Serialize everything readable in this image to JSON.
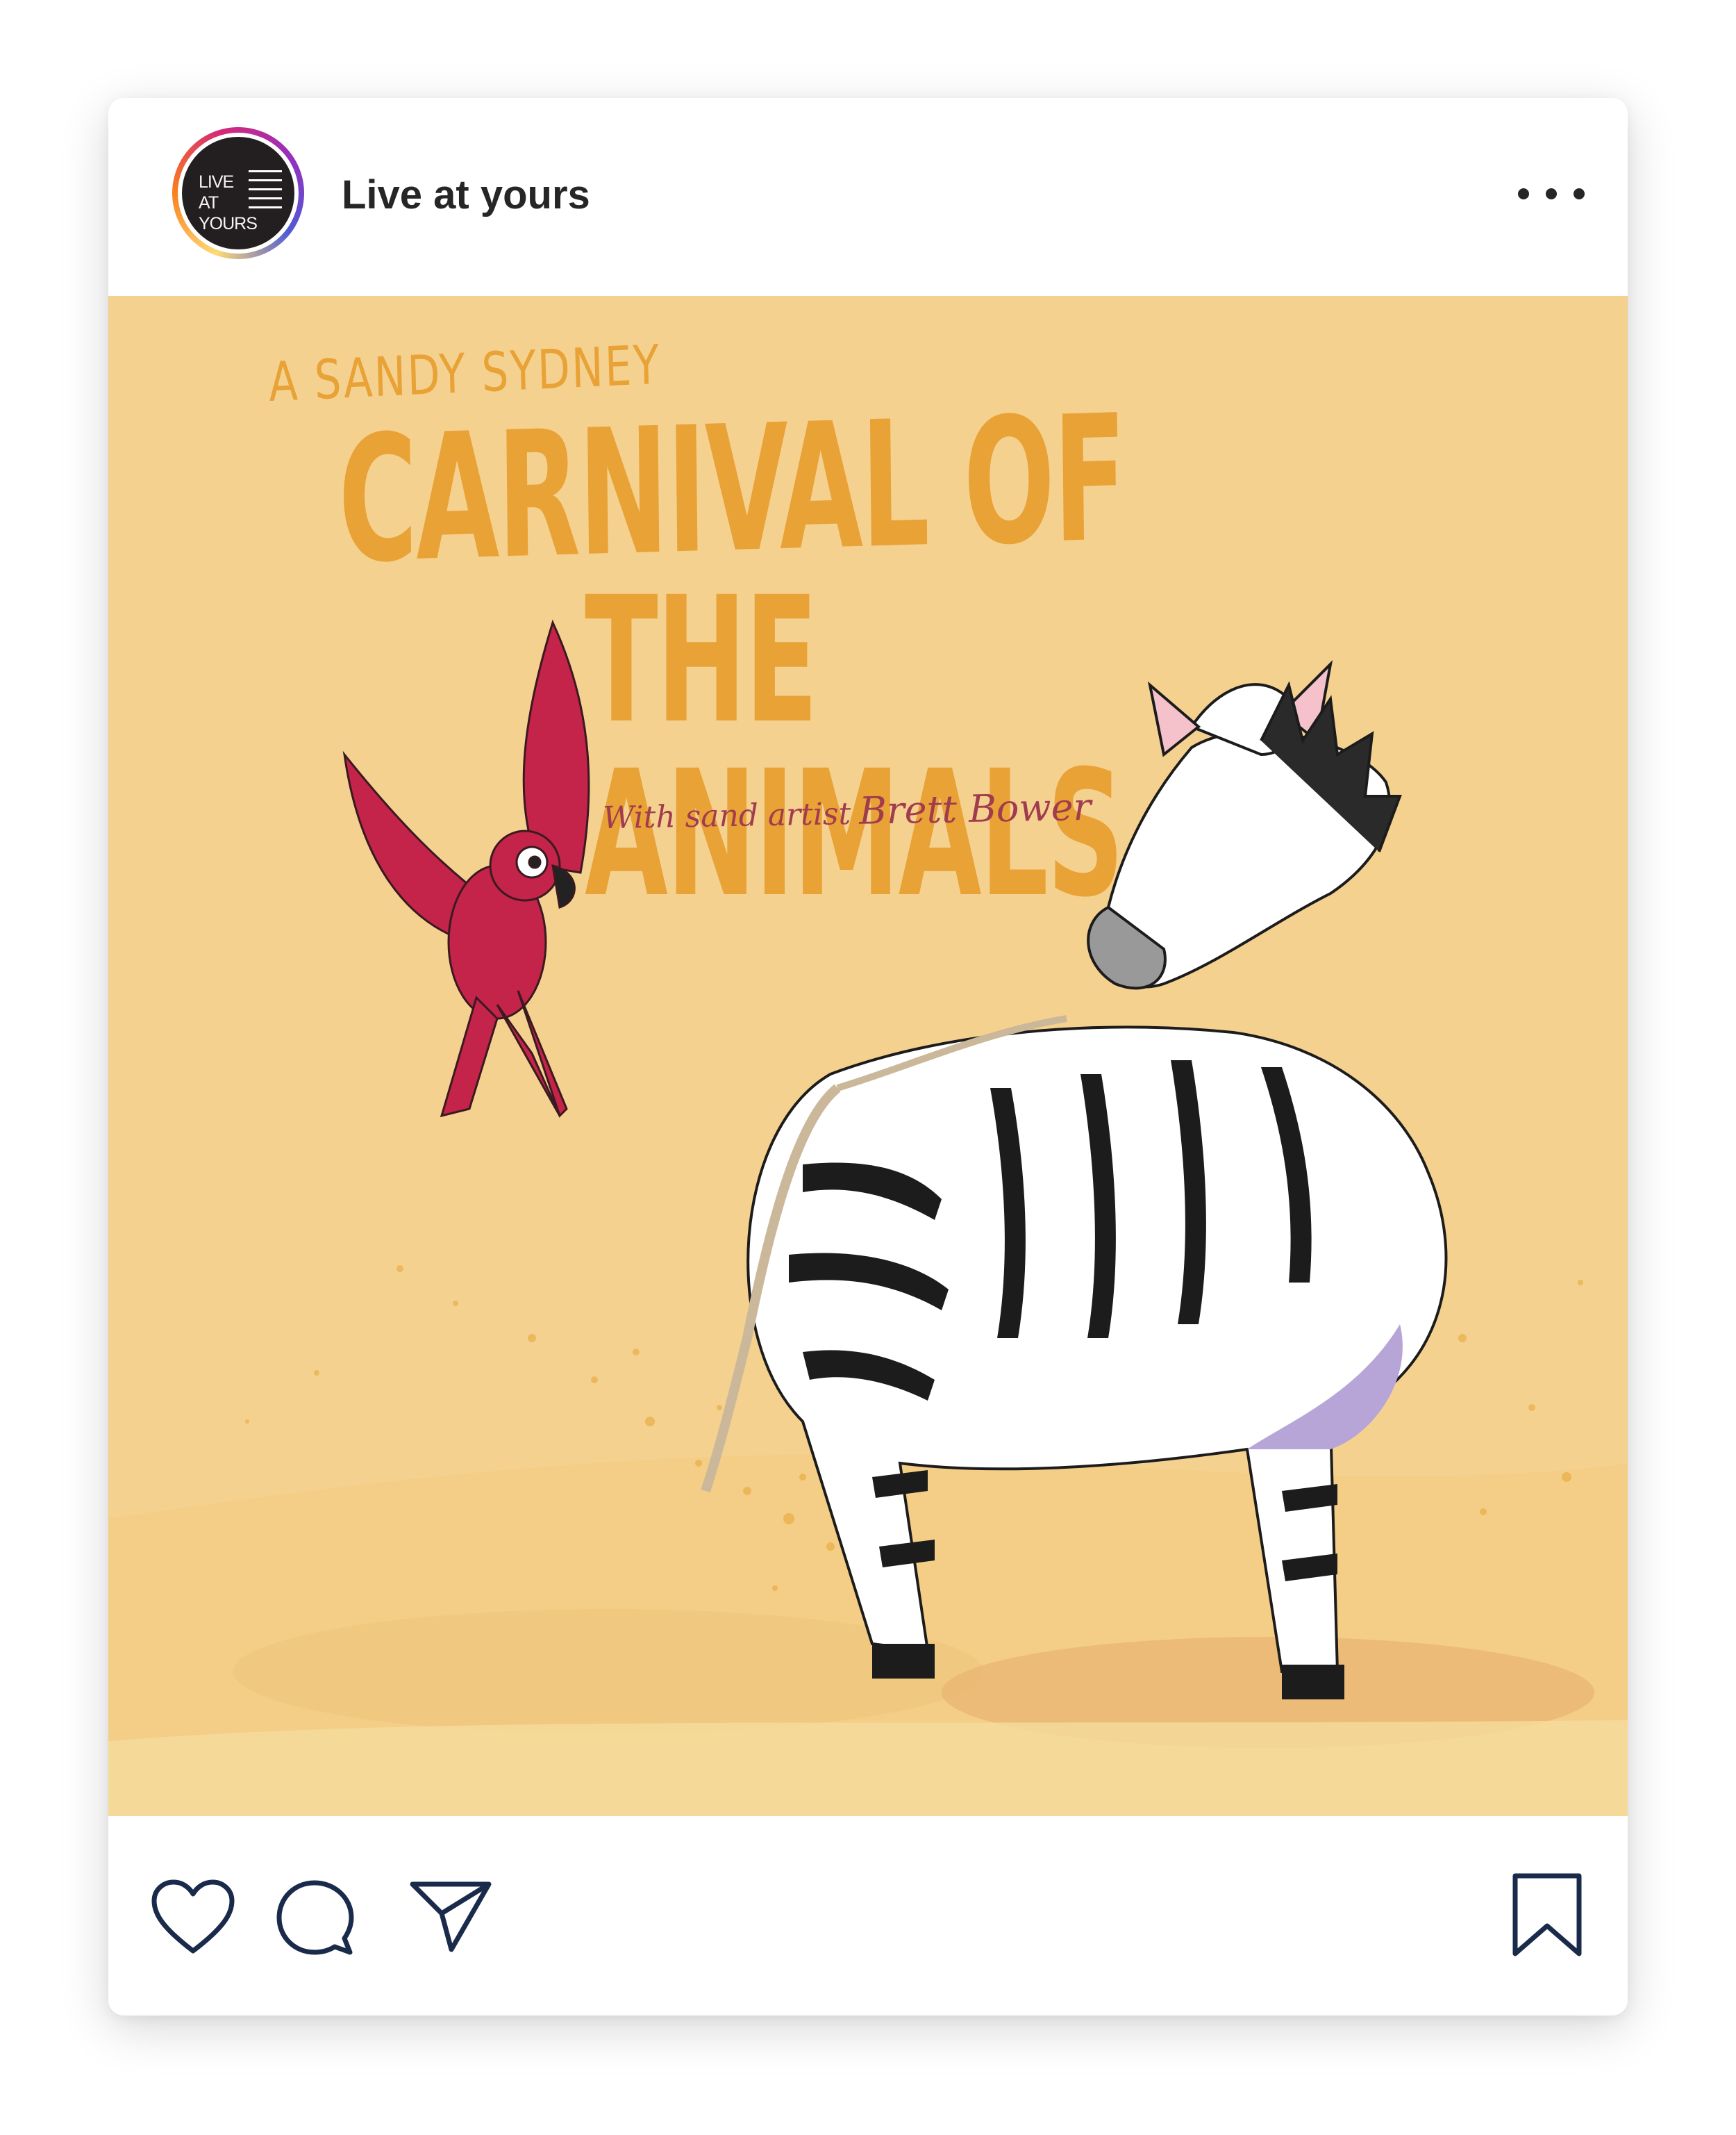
{
  "post": {
    "account": {
      "name": "Live at yours",
      "avatar_text_line1": "LIVE AT",
      "avatar_text_line2": "YOURS"
    },
    "more_options_icon": "more-horizontal-icon",
    "image": {
      "title_small": "A SANDY SYDNEY",
      "title_line1": "CARNIVAL OF",
      "title_line2": "THE ANIMALS",
      "subtitle_prefix": "With sand artist",
      "subtitle_artist": "Brett Bower"
    },
    "actions": {
      "like_icon": "heart-icon",
      "comment_icon": "comment-icon",
      "share_icon": "paper-plane-icon",
      "save_icon": "bookmark-icon"
    },
    "colors": {
      "background": "#f5d190",
      "title": "#e8a236",
      "subtitle": "#a13b4e",
      "parrot": "#c4234a",
      "zebra_shadow": "#b6a5d6"
    }
  }
}
